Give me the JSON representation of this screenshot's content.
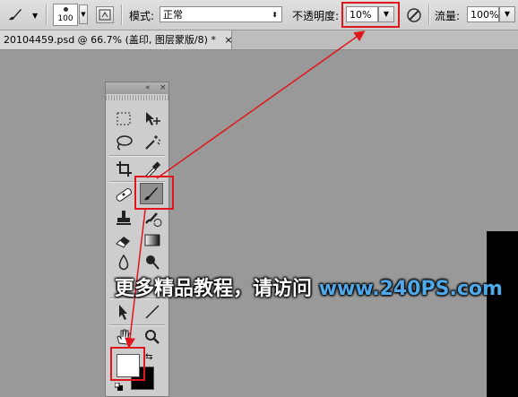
{
  "options_bar": {
    "brush_size": "100",
    "mode_label": "模式:",
    "mode_value": "正常",
    "opacity_label": "不透明度:",
    "opacity_value": "10%",
    "flow_label": "流量:",
    "flow_value": "100%"
  },
  "document_tab": {
    "title": "20104459.psd @ 66.7% (盖印, 图层蒙版/8) *",
    "close": "×"
  },
  "toolbox": {
    "collapse_glyph": "«",
    "close_glyph": "×"
  },
  "watermark": {
    "text": "更多精品教程，请访问",
    "url": "www.240PS.com"
  },
  "colors": {
    "highlight": "#e0161d",
    "arrow": "#e0161d",
    "canvas_background": "#999999",
    "watermark_url": "#4fa8e8"
  }
}
